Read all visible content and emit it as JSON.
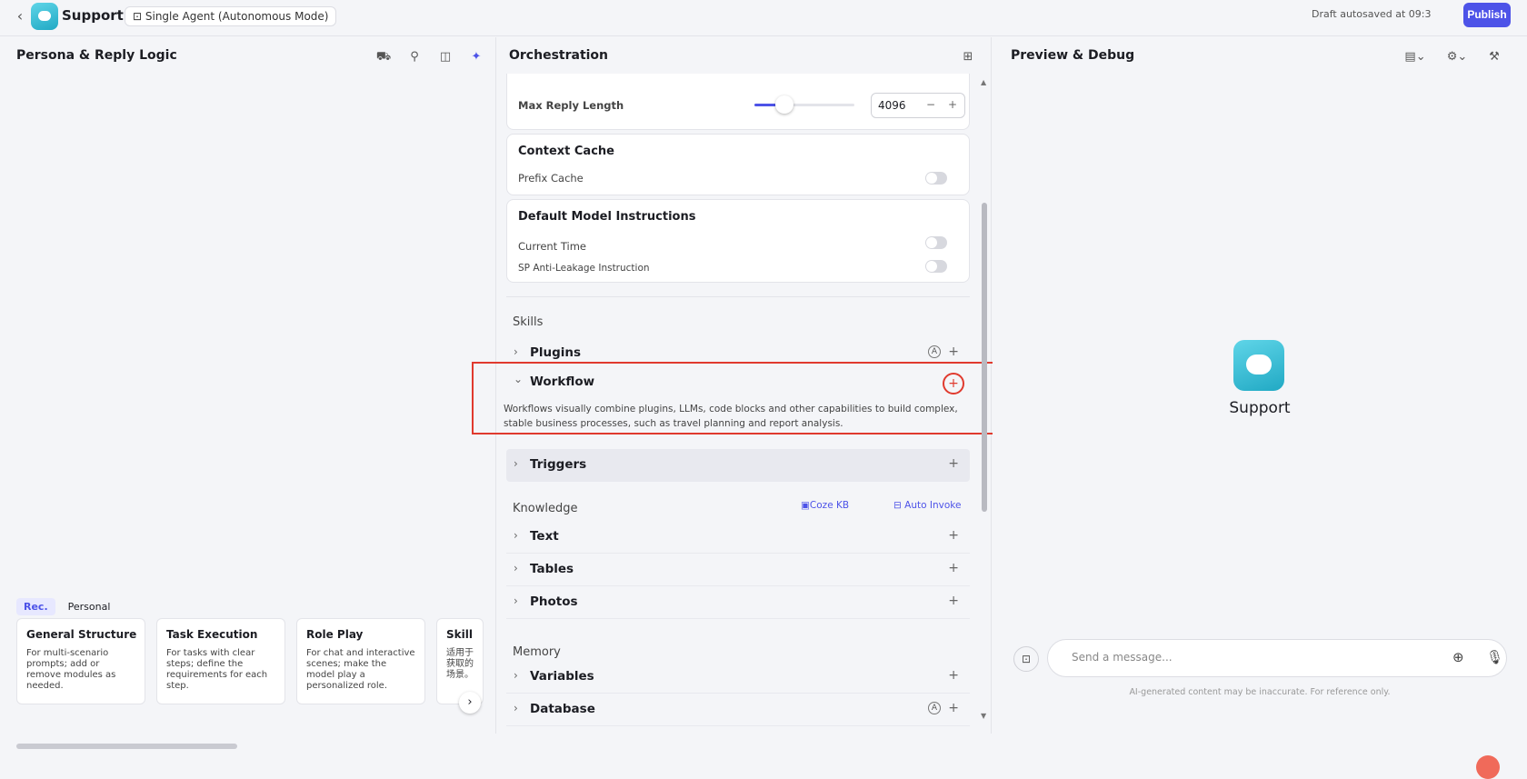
{
  "topbar": {
    "app_name": "Support",
    "mode_label": "Single Agent (Autonomous Mode)",
    "autosave": "Draft autosaved at 09:3",
    "publish_label": "Publish"
  },
  "left_panel": {
    "title": "Persona & Reply Logic",
    "icons": [
      "car-icon",
      "bulb-icon",
      "layout-icon",
      "sparkle-icon"
    ],
    "template_tabs": [
      "Rec.",
      "Personal"
    ],
    "templates": [
      {
        "title": "General Structure",
        "desc": "For multi-scenario prompts; add or remove modules as needed."
      },
      {
        "title": "Task Execution",
        "desc": "For tasks with clear steps; define the requirements for each step."
      },
      {
        "title": "Role Play",
        "desc": "For chat and interactive scenes; make the model play a personalized role."
      },
      {
        "title": "Skill",
        "desc": "适用于获取的场景。"
      }
    ]
  },
  "orchestration": {
    "title": "Orchestration",
    "max_reply_label": "Max Reply Length",
    "max_reply_value": "4096",
    "max_reply_fraction": 0.3,
    "context_cache": {
      "title": "Context Cache",
      "prefix_cache": "Prefix Cache"
    },
    "default_instructions": {
      "title": "Default Model Instructions",
      "current_time": "Current Time",
      "sp_anti_leakage": "SP Anti-Leakage Instruction"
    },
    "skills_label": "Skills",
    "plugins_label": "Plugins",
    "workflow_label": "Workflow",
    "workflow_desc": "Workflows visually combine plugins, LLMs, code blocks and other capabilities to build complex, stable business processes, such as travel planning and report analysis.",
    "triggers_label": "Triggers",
    "knowledge_label": "Knowledge",
    "kb_option": "Coze KB",
    "auto_invoke": "Auto Invoke",
    "text_label": "Text",
    "tables_label": "Tables",
    "photos_label": "Photos",
    "memory_label": "Memory",
    "variables_label": "Variables",
    "database_label": "Database"
  },
  "preview": {
    "title": "Preview & Debug",
    "bot_name": "Support",
    "placeholder": "Send a message...",
    "disclaimer": "AI-generated content may be inaccurate. For reference only."
  },
  "colors": {
    "accent": "#4d53e8",
    "highlight": "#e03a2e"
  }
}
